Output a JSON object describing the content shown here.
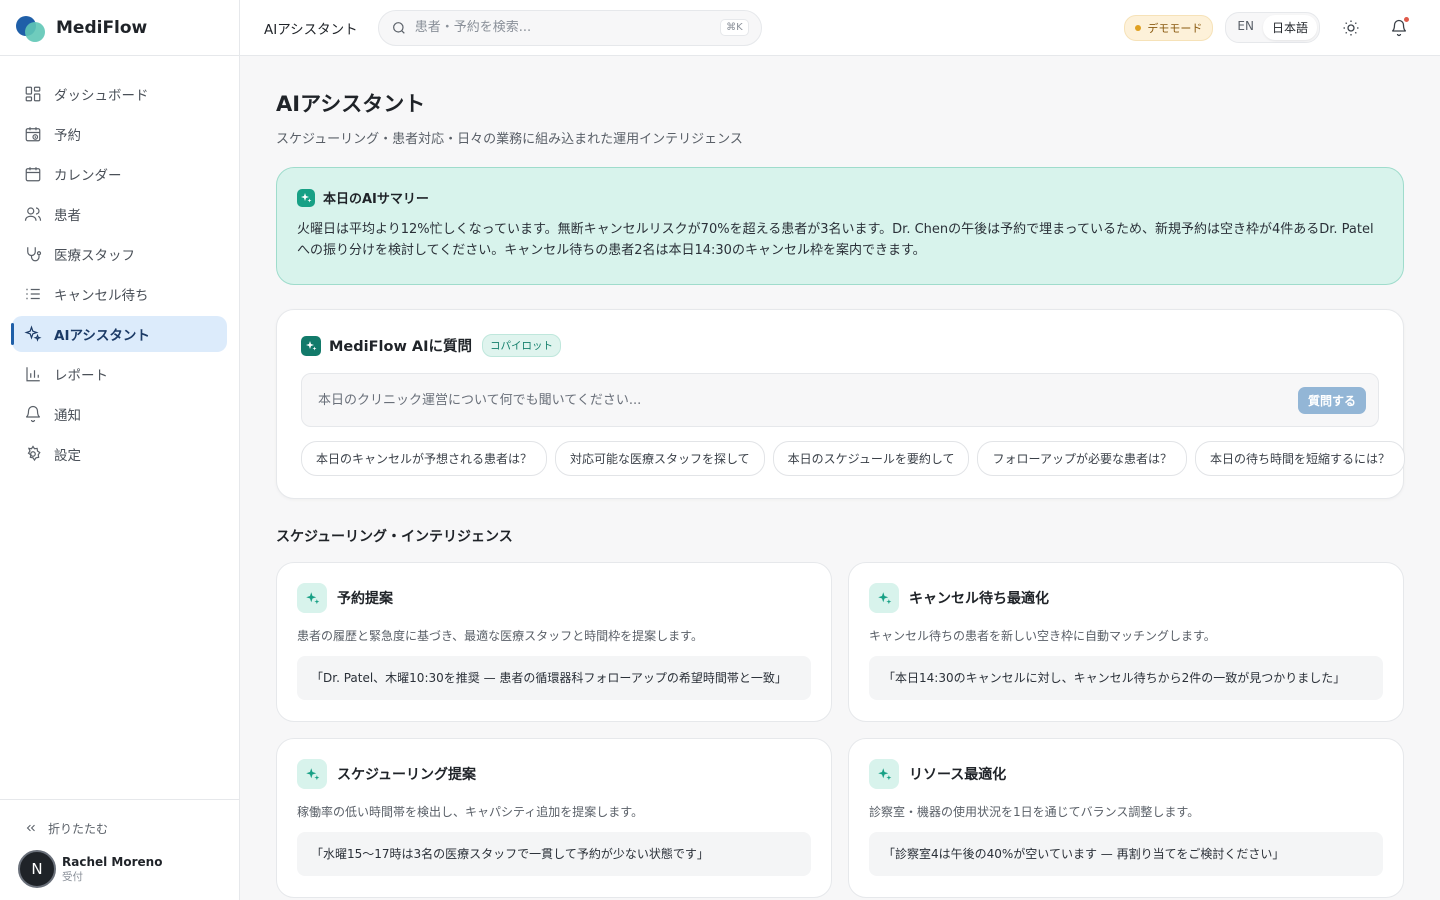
{
  "brand": {
    "name": "MediFlow"
  },
  "sidebar": {
    "items": [
      {
        "label": "ダッシュボード",
        "icon": "dashboard-icon"
      },
      {
        "label": "予約",
        "icon": "calendar-clock-icon"
      },
      {
        "label": "カレンダー",
        "icon": "calendar-icon"
      },
      {
        "label": "患者",
        "icon": "users-icon"
      },
      {
        "label": "医療スタッフ",
        "icon": "stethoscope-icon"
      },
      {
        "label": "キャンセル待ち",
        "icon": "list-icon"
      },
      {
        "label": "AIアシスタント",
        "icon": "sparkles-icon",
        "active": true
      },
      {
        "label": "レポート",
        "icon": "bar-chart-icon"
      },
      {
        "label": "通知",
        "icon": "bell-icon"
      },
      {
        "label": "設定",
        "icon": "gear-icon"
      }
    ],
    "collapse_label": "折りたたむ",
    "user": {
      "initial": "N",
      "name": "Rachel Moreno",
      "role": "受付"
    }
  },
  "topbar": {
    "title": "AIアシスタント",
    "search_placeholder": "患者・予約を検索...",
    "shortcut": "⌘K",
    "demo_label": "デモモード",
    "lang_en": "EN",
    "lang_ja": "日本語"
  },
  "page": {
    "title": "AIアシスタント",
    "subtitle": "スケジューリング・患者対応・日々の業務に組み込まれた運用インテリジェンス"
  },
  "summary": {
    "title": "本日のAIサマリー",
    "text": "火曜日は平均より12%忙しくなっています。無断キャンセルリスクが70%を超える患者が3名います。Dr. Chenの午後は予約で埋まっているため、新規予約は空き枠が4件あるDr. Patelへの振り分けを検討してください。キャンセル待ちの患者2名は本日14:30のキャンセル枠を案内できます。"
  },
  "ask": {
    "title": "MediFlow AIに質問",
    "badge": "コパイロット",
    "placeholder": "本日のクリニック運営について何でも聞いてください...",
    "button": "質問する",
    "chips": [
      "本日のキャンセルが予想される患者は？",
      "対応可能な医療スタッフを探して",
      "本日のスケジュールを要約して",
      "フォローアップが必要な患者は？",
      "本日の待ち時間を短縮するには？"
    ]
  },
  "section": {
    "title": "スケジューリング・インテリジェンス",
    "cards": [
      {
        "title": "予約提案",
        "desc": "患者の履歴と緊急度に基づき、最適な医療スタッフと時間枠を提案します。",
        "quote": "「Dr. Patel、木曜10:30を推奨 — 患者の循環器科フォローアップの希望時間帯と一致」"
      },
      {
        "title": "キャンセル待ち最適化",
        "desc": "キャンセル待ちの患者を新しい空き枠に自動マッチングします。",
        "quote": "「本日14:30のキャンセルに対し、キャンセル待ちから2件の一致が見つかりました」"
      },
      {
        "title": "スケジューリング提案",
        "desc": "稼働率の低い時間帯を検出し、キャパシティ追加を提案します。",
        "quote": "「水曜15〜17時は3名の医療スタッフで一貫して予約が少ない状態です」"
      },
      {
        "title": "リソース最適化",
        "desc": "診察室・機器の使用状況を1日を通じてバランス調整します。",
        "quote": "「診察室4は午後の40%が空いています — 再割り当てをご検討ください」"
      }
    ]
  },
  "colors": {
    "accent": "#17a085",
    "primary": "#1f5fa8",
    "active_bg": "#dcebfb",
    "summary_bg": "#d8f3ec"
  }
}
